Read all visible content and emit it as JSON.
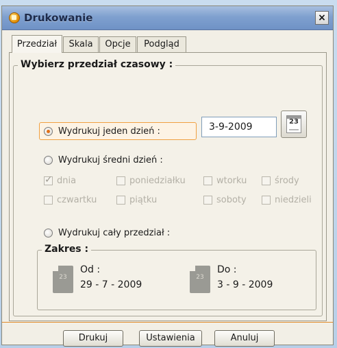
{
  "window": {
    "title": "Drukowanie",
    "close_label": "×"
  },
  "tabs": [
    {
      "label": "Przedział",
      "active": true
    },
    {
      "label": "Skala",
      "active": false
    },
    {
      "label": "Opcje",
      "active": false
    },
    {
      "label": "Podgląd",
      "active": false
    }
  ],
  "group": {
    "title": "Wybierz przedział czasowy :"
  },
  "options": {
    "single_day": {
      "label": "Wydrukuj jeden dzień :",
      "checked": true,
      "date_value": "3-9-2009",
      "calendar_icon_text": "23"
    },
    "average_day": {
      "label": "Wydrukuj średni dzień :",
      "checked": false
    },
    "whole_range": {
      "label": "Wydrukuj cały przedział :",
      "checked": false
    }
  },
  "days": [
    {
      "label": "dnia",
      "checked": true
    },
    {
      "label": "poniedziałku",
      "checked": false
    },
    {
      "label": "wtorku",
      "checked": false
    },
    {
      "label": "środy",
      "checked": false
    },
    {
      "label": "czwartku",
      "checked": false
    },
    {
      "label": "piątku",
      "checked": false
    },
    {
      "label": "soboty",
      "checked": false
    },
    {
      "label": "niedzieli",
      "checked": false
    }
  ],
  "range": {
    "title": "Zakres :",
    "icon_text": "23",
    "from_label": "Od :",
    "from_value": "29 - 7 - 2009",
    "to_label": "Do :",
    "to_value": "3 - 9 - 2009"
  },
  "buttons": {
    "print": "Drukuj",
    "settings": "Ustawienia",
    "cancel": "Anuluj"
  },
  "colors": {
    "accent": "#e08a2a",
    "radio_selected": "#e0701a",
    "title_bar": "#7fa0cf"
  }
}
